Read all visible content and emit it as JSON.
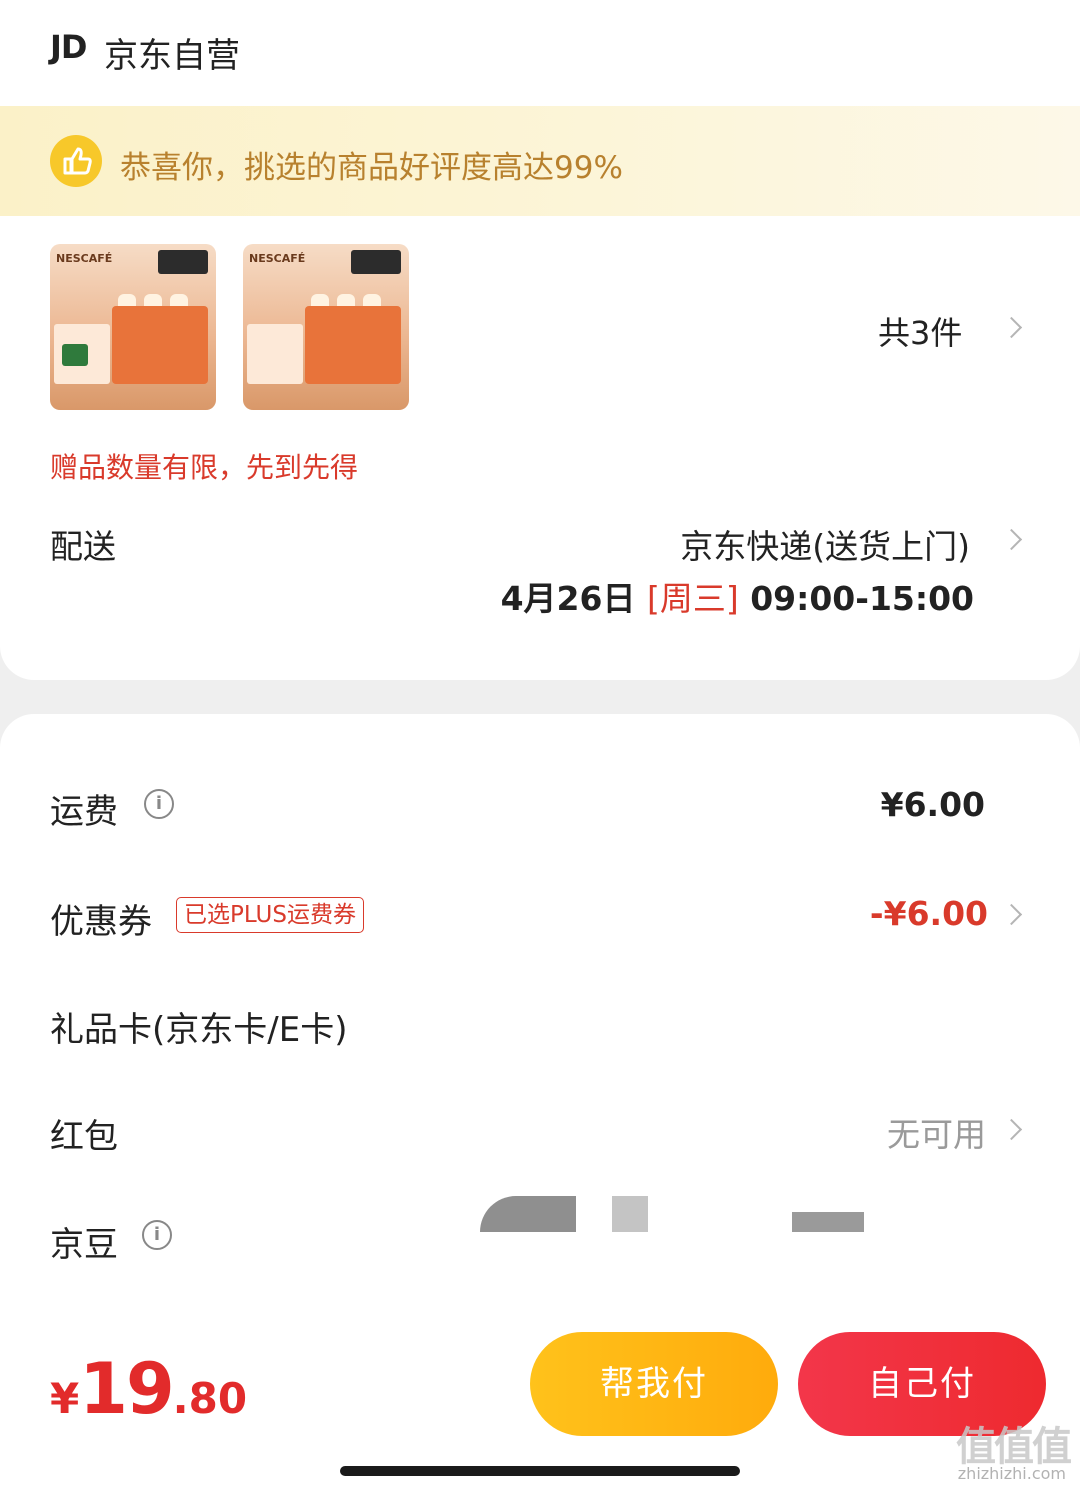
{
  "shop": {
    "logo": "JD",
    "name": "京东自营"
  },
  "banner": {
    "icon": "thumbs-up-icon",
    "text": "恭喜你，挑选的商品好评度高达99%"
  },
  "products": [
    {
      "brand": "NESCAFÉ"
    },
    {
      "brand": "NESCAFÉ"
    }
  ],
  "count_label": "共3件",
  "gift_note": "赠品数量有限，先到先得",
  "shipping": {
    "label": "配送",
    "method": "京东快递(送货上门)",
    "date": "4月26日",
    "weekday": "[周三]",
    "time": "09:00-15:00"
  },
  "fees": {
    "freight": {
      "label": "运费",
      "value": "¥6.00"
    },
    "coupon": {
      "label": "优惠券",
      "tag": "已选PLUS运费券",
      "value": "-¥6.00"
    },
    "gift_card": {
      "label": "礼品卡(京东卡/E卡)"
    },
    "red_packet": {
      "label": "红包",
      "value": "无可用"
    },
    "jd_beans": {
      "label": "京豆"
    }
  },
  "footer": {
    "currency": "¥",
    "total_int": "19",
    "total_dec": ".80",
    "help_pay": "帮我付",
    "self_pay": "自己付"
  },
  "watermark": {
    "title": "值值值",
    "site": "zhizhizhi.com"
  },
  "colors": {
    "accent_red": "#e22b2b",
    "help_yellow": "#ffc21b",
    "banner_text": "#b8812e"
  }
}
